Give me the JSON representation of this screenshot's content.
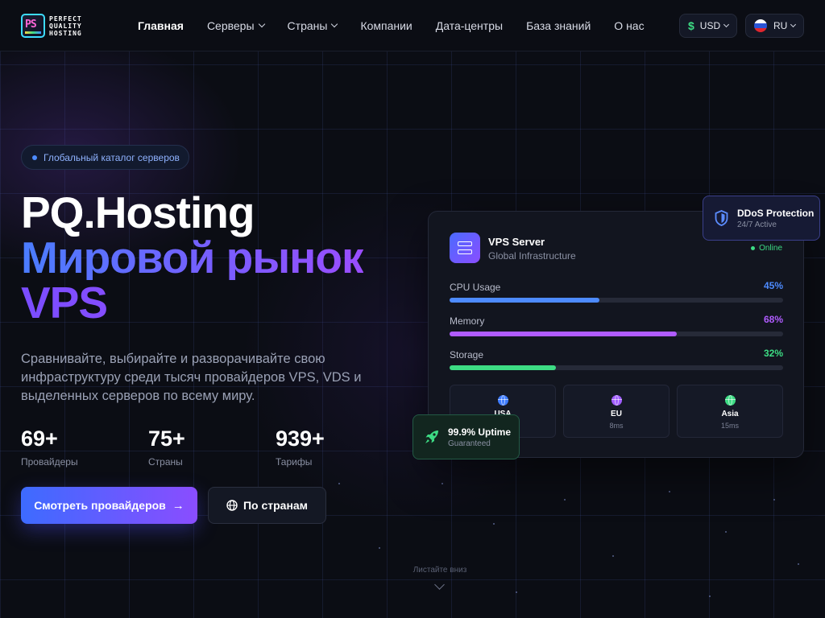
{
  "logo": {
    "line1": "PERFECT",
    "line2": "QUALITY",
    "line3": "HOSTING",
    "mark": "PS"
  },
  "nav": [
    {
      "label": "Главная",
      "active": true,
      "dropdown": false
    },
    {
      "label": "Серверы",
      "active": false,
      "dropdown": true
    },
    {
      "label": "Страны",
      "active": false,
      "dropdown": true
    },
    {
      "label": "Компании",
      "active": false,
      "dropdown": false
    },
    {
      "label": "Дата-центры",
      "active": false,
      "dropdown": false
    },
    {
      "label": "База знаний",
      "active": false,
      "dropdown": false
    },
    {
      "label": "О нас",
      "active": false,
      "dropdown": false
    }
  ],
  "currency": {
    "symbol": "$",
    "value": "USD"
  },
  "language": {
    "value": "RU"
  },
  "hero": {
    "badge": "Глобальный каталог серверов",
    "title_line1": "PQ.Hosting",
    "title_line2": "Мировой рынок",
    "title_line3": "VPS",
    "lead": "Сравнивайте, выбирайте и разворачивайте свою инфраструктуру среди тысяч провайдеров VPS, VDS и выделенных серверов по всему миру.",
    "stats": [
      {
        "value": "69+",
        "label": "Провайдеры"
      },
      {
        "value": "75+",
        "label": "Страны"
      },
      {
        "value": "939+",
        "label": "Тарифы"
      }
    ],
    "primary_button": "Смотреть провайдеров",
    "secondary_button": "По странам",
    "scroll_hint": "Листайте вниз"
  },
  "server_card": {
    "title": "VPS Server",
    "subtitle": "Global Infrastructure",
    "status": "Online",
    "metrics": [
      {
        "label": "CPU Usage",
        "value": "45%",
        "fraction": 0.45,
        "color": "#4d8bff"
      },
      {
        "label": "Memory",
        "value": "68%",
        "fraction": 0.68,
        "color": "#b05cff"
      },
      {
        "label": "Storage",
        "value": "32%",
        "fraction": 0.32,
        "color": "#3ddc84"
      }
    ],
    "regions": [
      {
        "name": "USA",
        "latency": "",
        "icon": "globe-icon",
        "color": "#3d7bff"
      },
      {
        "name": "EU",
        "latency": "8ms",
        "icon": "globe-icon",
        "color": "#a05cff"
      },
      {
        "name": "Asia",
        "latency": "15ms",
        "icon": "globe-icon",
        "color": "#3ddc84"
      }
    ]
  },
  "ddos": {
    "title": "DDoS Protection",
    "subtitle": "24/7 Active",
    "icon": "shield-icon"
  },
  "uptime": {
    "title": "99.9% Uptime",
    "subtitle": "Guaranteed",
    "icon": "rocket-icon"
  },
  "colors": {
    "accent_blue": "#3d6bff",
    "accent_purple": "#8a4dff",
    "online_green": "#3ddc84",
    "background": "#0b0d14"
  }
}
